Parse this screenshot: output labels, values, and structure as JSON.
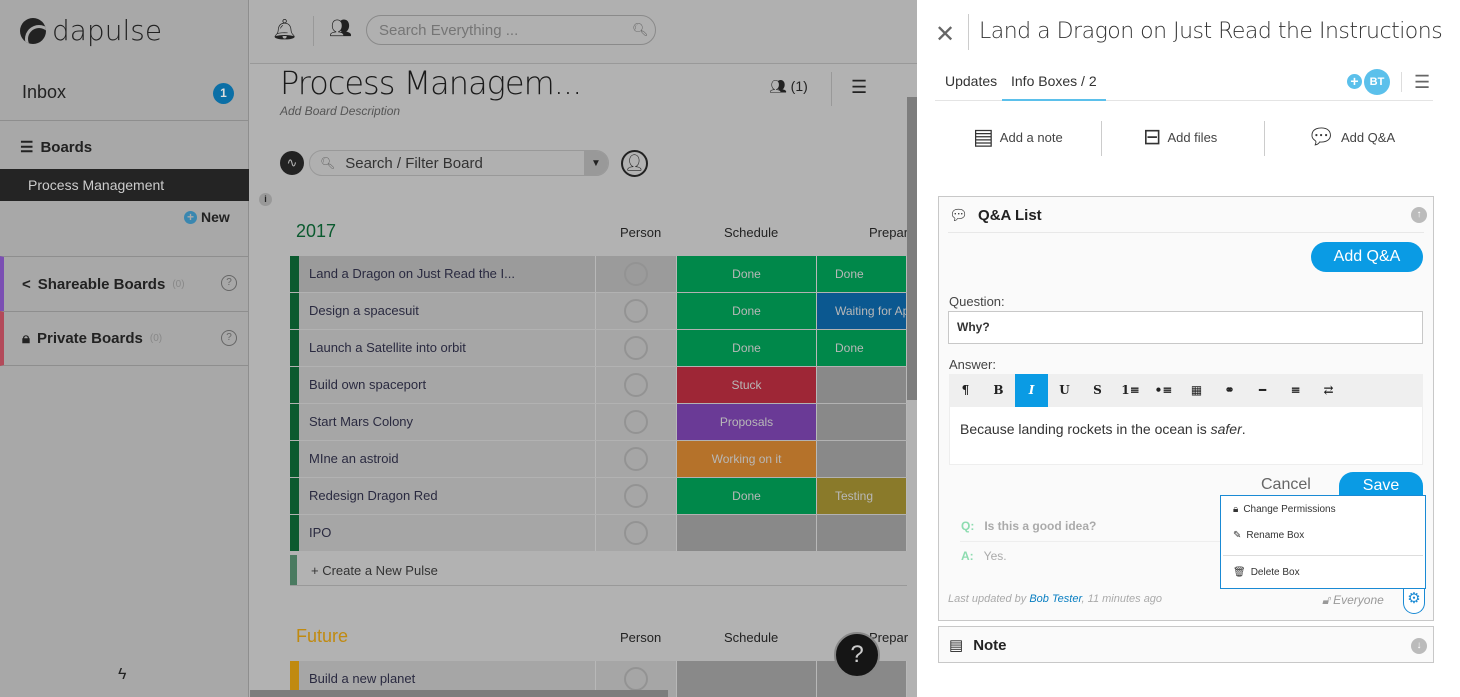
{
  "sidebar": {
    "logo": "dapulse",
    "inbox": "Inbox",
    "inbox_count": "1",
    "boards_header": "Boards",
    "selected_board": "Process Management",
    "new_label": "New",
    "sections": [
      {
        "label": "Shareable Boards",
        "count": "(0)",
        "color": "#7b4fb3"
      },
      {
        "label": "Private Boards",
        "count": "(0)",
        "color": "#b34a5a"
      }
    ]
  },
  "topbar": {
    "search_placeholder": "Search Everything ..."
  },
  "board": {
    "title": "Process Managem...",
    "description": "Add Board Description",
    "subscribers": "(1)",
    "filter_placeholder": "Search / Filter Board",
    "columns": [
      "Person",
      "Schedule",
      "Prepar"
    ],
    "groups": [
      {
        "name": "2017",
        "color": "#0b5a2f",
        "rows": [
          {
            "name": "Land a Dragon on Just Read the I...",
            "schedule": "Done",
            "schedule_color": "#00884a",
            "prep": "Done",
            "prep_color": "#00884a"
          },
          {
            "name": "Design a spacesuit",
            "schedule": "Done",
            "schedule_color": "#00884a",
            "prep": "Waiting for Ap",
            "prep_color": "#0b5890"
          },
          {
            "name": "Launch a Satellite into orbit",
            "schedule": "Done",
            "schedule_color": "#00884a",
            "prep": "Done",
            "prep_color": "#00884a"
          },
          {
            "name": "Build own spaceport",
            "schedule": "Stuck",
            "schedule_color": "#9e2636",
            "prep": "",
            "prep_color": "#898989"
          },
          {
            "name": "Start Mars Colony",
            "schedule": "Proposals",
            "schedule_color": "#6a3a96",
            "prep": "",
            "prep_color": "#898989"
          },
          {
            "name": "MIne an astroid",
            "schedule": "Working on it",
            "schedule_color": "#b5722a",
            "prep": "",
            "prep_color": "#898989"
          },
          {
            "name": "Redesign Dragon Red",
            "schedule": "Done",
            "schedule_color": "#00884a",
            "prep": "Testing",
            "prep_color": "#8a7a2a"
          },
          {
            "name": "IPO",
            "schedule": "",
            "schedule_color": "#898989",
            "prep": "",
            "prep_color": "#898989"
          }
        ],
        "create_label": "+ Create a New Pulse"
      },
      {
        "name": "Future",
        "color": "#c08a10",
        "rows": [
          {
            "name": "Build a new planet",
            "schedule": "",
            "schedule_color": "#898989",
            "prep": "",
            "prep_color": "#898989"
          }
        ]
      }
    ]
  },
  "help": "?",
  "panel": {
    "title": "Land a Dragon on Just Read the Instructions",
    "tabs": [
      "Updates",
      "Info Boxes / 2"
    ],
    "active_tab": 1,
    "avatar": "BT",
    "add_buttons": [
      "Add a note",
      "Add files",
      "Add Q&A"
    ],
    "qa_box": {
      "title": "Q&A List",
      "add_button": "Add Q&A",
      "question_label": "Question:",
      "question_value": "Why?",
      "answer_label": "Answer:",
      "toolbar": [
        "¶",
        "B",
        "I",
        "U",
        "S",
        "1≡",
        "•≡",
        "▦",
        "⚭",
        "━",
        "≡",
        "⇄"
      ],
      "active_tool": 2,
      "answer_text": "Because landing rockets in the ocean is ",
      "answer_italic": "safer",
      "answer_end": ".",
      "cancel": "Cancel",
      "save": "Save",
      "q_label": "Q:",
      "question": "Is this a good idea?",
      "a_label": "A:",
      "answer": "Yes.",
      "footer_prefix": "Last updated by ",
      "footer_user": "Bob Tester",
      "footer_suffix": ", 11 minutes ago",
      "permission": "Everyone",
      "menu": [
        "Change Permissions",
        "Rename Box",
        "Delete Box"
      ]
    },
    "note_box": {
      "title": "Note"
    }
  },
  "colors": {
    "accent": "#0a9be4",
    "tab_underline": "#5bc0eb"
  }
}
